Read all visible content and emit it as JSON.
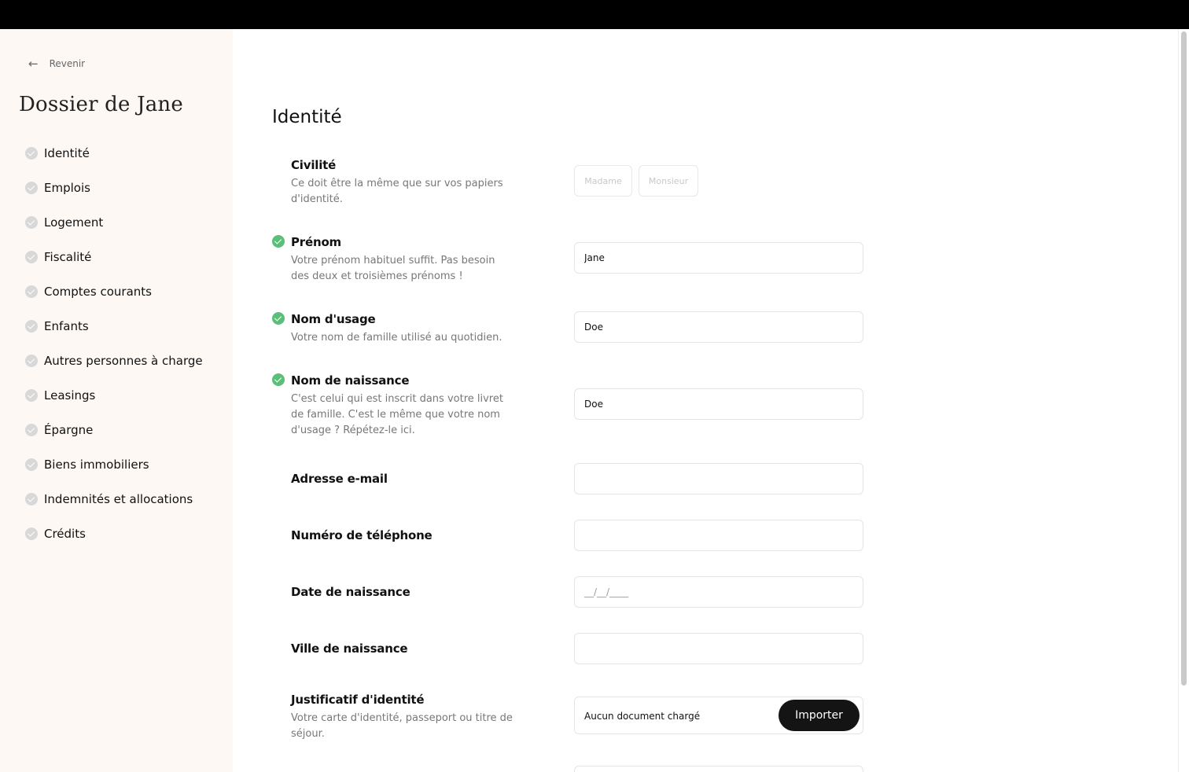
{
  "back": {
    "label": "Revenir",
    "icon": "arrow-left-icon"
  },
  "dossier_title": "Dossier de Jane",
  "nav": [
    {
      "label": "Identité"
    },
    {
      "label": "Emplois"
    },
    {
      "label": "Logement"
    },
    {
      "label": "Fiscalité"
    },
    {
      "label": "Comptes courants"
    },
    {
      "label": "Enfants"
    },
    {
      "label": "Autres personnes à charge"
    },
    {
      "label": "Leasings"
    },
    {
      "label": "Épargne"
    },
    {
      "label": "Biens immobiliers"
    },
    {
      "label": "Indemnités et allocations"
    },
    {
      "label": "Crédits"
    }
  ],
  "section_title": "Identité",
  "fields": {
    "civilite": {
      "label": "Civilité",
      "help": "Ce doit être la même que sur vos papiers d'identité.",
      "options": [
        "Madame",
        "Monsieur"
      ]
    },
    "prenom": {
      "label": "Prénom",
      "help": "Votre prénom habituel suffit. Pas besoin des deux et troisièmes prénoms !",
      "value": "Jane"
    },
    "nom_usage": {
      "label": "Nom d'usage",
      "help": "Votre nom de famille utilisé au quotidien.",
      "value": "Doe"
    },
    "nom_naissance": {
      "label": "Nom de naissance",
      "help": "C'est celui qui est inscrit dans votre livret de famille. C'est le même que votre nom d'usage ? Répétez-le ici.",
      "value": "Doe"
    },
    "email": {
      "label": "Adresse e-mail",
      "value": ""
    },
    "telephone": {
      "label": "Numéro de téléphone",
      "value": ""
    },
    "date_naissance": {
      "label": "Date de naissance",
      "placeholder": "__/__/____"
    },
    "ville_naissance": {
      "label": "Ville de naissance",
      "value": ""
    },
    "justificatif": {
      "label": "Justificatif d'identité",
      "help": "Votre carte d'identité, passeport ou titre de séjour.",
      "status": "Aucun document chargé",
      "button": "Importer"
    }
  },
  "colors": {
    "sidebar_bg": "#fdf8f3",
    "check_done": "#5bbf7a",
    "check_pending": "#d8d8d8",
    "button_dark": "#141414"
  }
}
